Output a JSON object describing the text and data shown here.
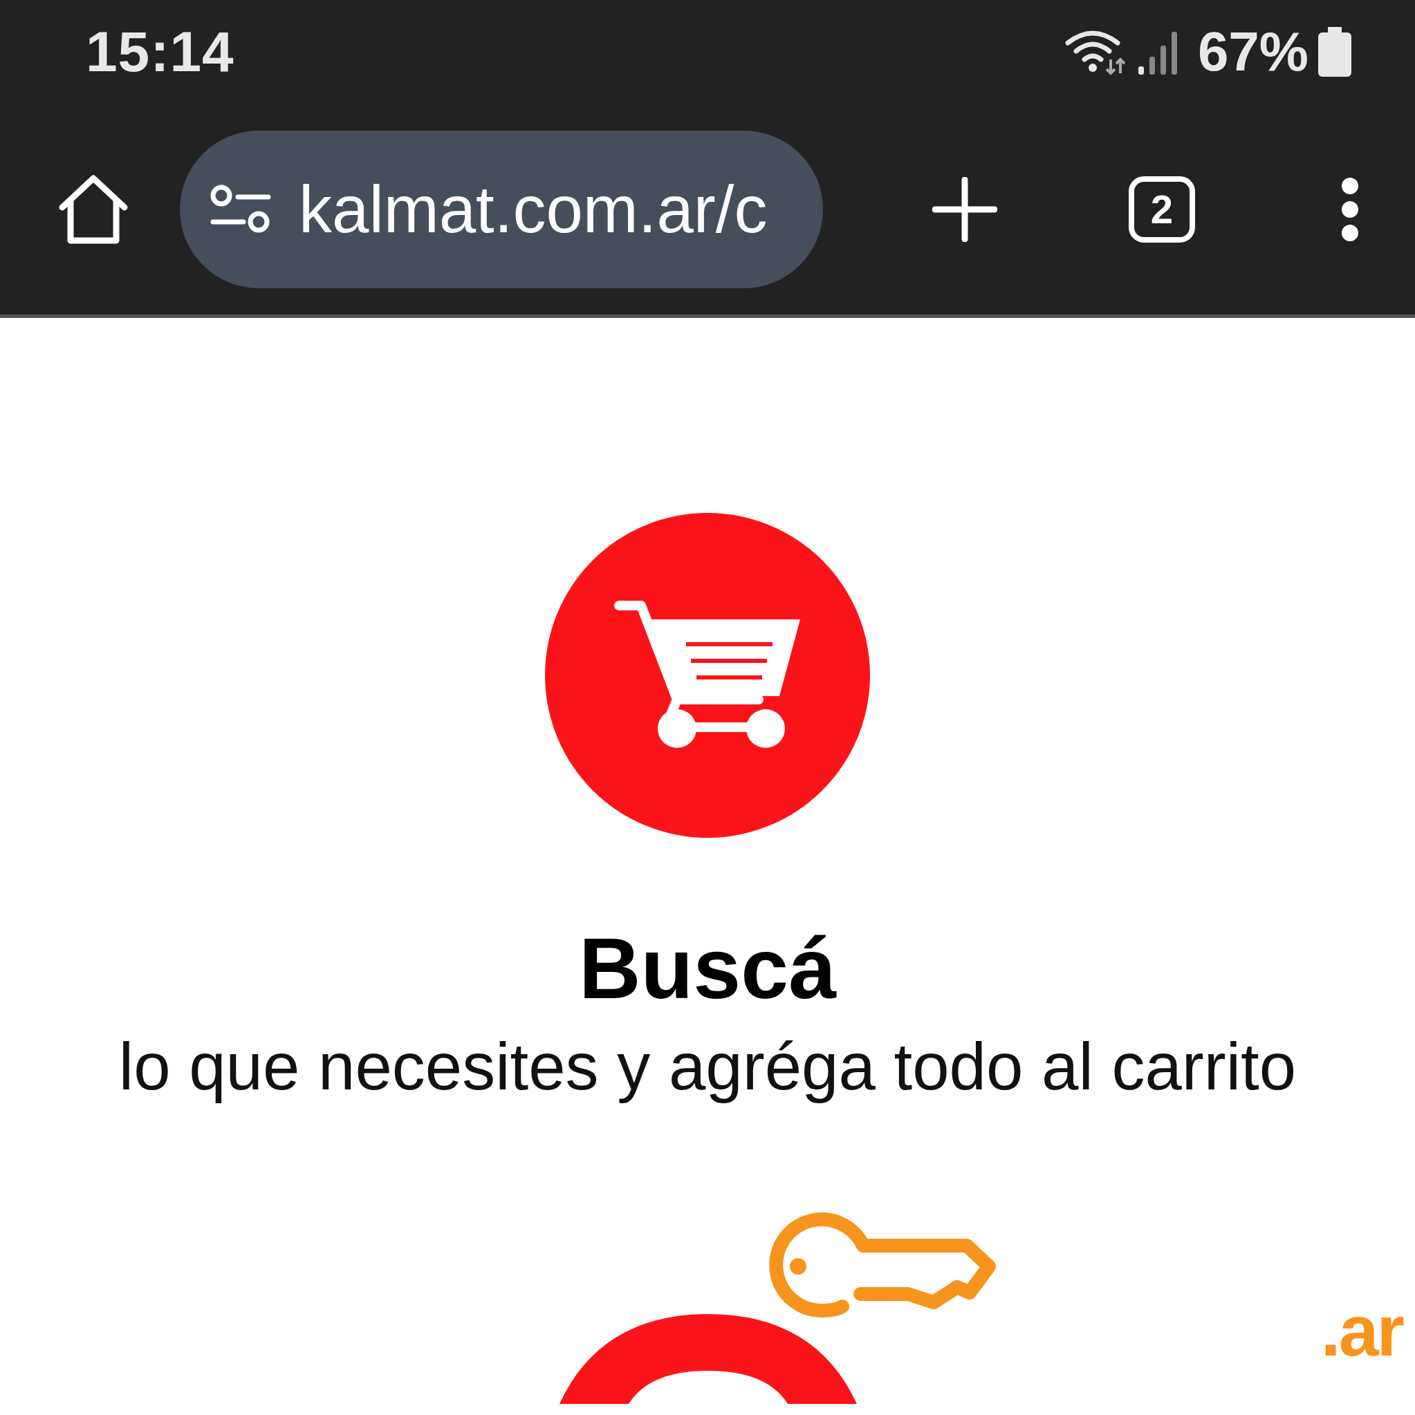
{
  "status_bar": {
    "time": "15:14",
    "battery": "67%"
  },
  "browser_toolbar": {
    "url": "kalmat.com.ar/c",
    "tab_count": "2"
  },
  "feature": {
    "title": "Buscá",
    "text": "lo que necesites y agréga todo al carrito"
  },
  "domain_mark": ".ar"
}
